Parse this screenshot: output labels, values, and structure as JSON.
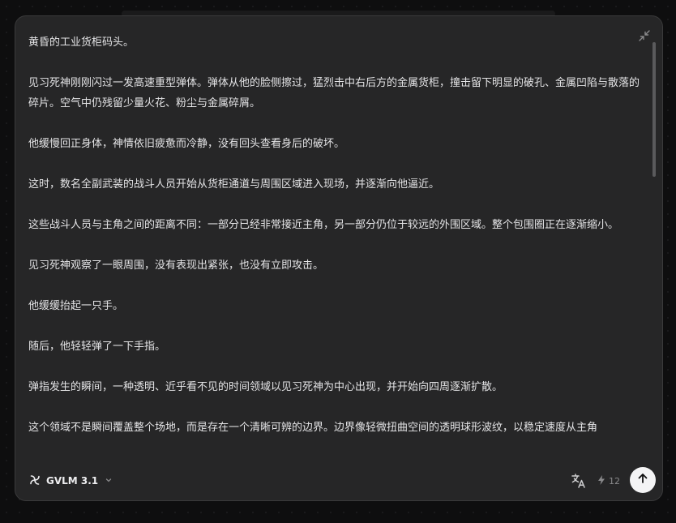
{
  "content": {
    "paragraphs": [
      "黄昏的工业货柜码头。",
      "见习死神刚刚闪过一发高速重型弹体。弹体从他的脸侧擦过，猛烈击中右后方的金属货柜，撞击留下明显的破孔、金属凹陷与散落的碎片。空气中仍残留少量火花、粉尘与金属碎屑。",
      "他缓慢回正身体，神情依旧疲惫而冷静，没有回头查看身后的破坏。",
      "这时，数名全副武装的战斗人员开始从货柜通道与周围区域进入现场，并逐渐向他逼近。",
      "这些战斗人员与主角之间的距离不同：一部分已经非常接近主角，另一部分仍位于较远的外围区域。整个包围圈正在逐渐缩小。",
      "见习死神观察了一眼周围，没有表现出紧张，也没有立即攻击。",
      "他缓缓抬起一只手。",
      "随后，他轻轻弹了一下手指。",
      "弹指发生的瞬间，一种透明、近乎看不见的时间领域以见习死神为中心出现，并开始向四周逐渐扩散。",
      "这个领域不是瞬间覆盖整个场地，而是存在一个清晰可辨的边界。边界像轻微扭曲空间的透明球形波纹，以稳定速度从主角"
    ]
  },
  "footer": {
    "model_name": "GVLM 3.1",
    "credits_count": "12"
  },
  "icons": {
    "collapse": "collapse-arrows-icon",
    "model_logo": "pinwheel-logo-icon",
    "chevron": "chevron-down-icon",
    "translate": "translate-icon",
    "credits": "bolt-icon",
    "send": "arrow-up-icon"
  }
}
